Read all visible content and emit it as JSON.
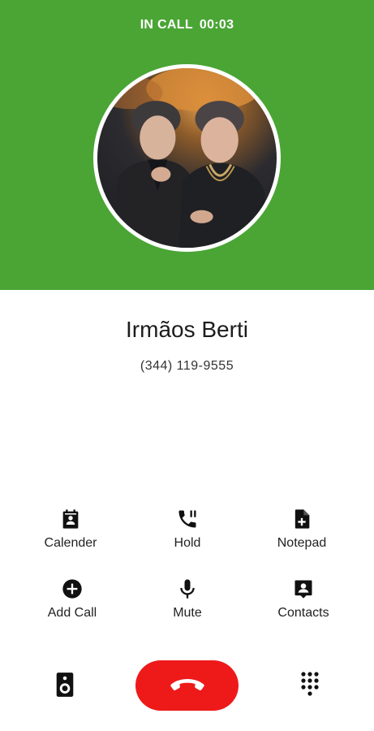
{
  "call": {
    "status_label": "IN CALL",
    "duration": "00:03"
  },
  "contact": {
    "name": "Irmãos Berti",
    "number": "(344) 119-9555"
  },
  "actions": [
    {
      "label": "Calender",
      "icon": "calendar-icon"
    },
    {
      "label": "Hold",
      "icon": "phone-pause-icon"
    },
    {
      "label": "Notepad",
      "icon": "note-add-icon"
    },
    {
      "label": "Add Call",
      "icon": "add-circle-icon"
    },
    {
      "label": "Mute",
      "icon": "microphone-icon"
    },
    {
      "label": "Contacts",
      "icon": "contact-icon"
    }
  ],
  "bottom_bar": {
    "left_icon": "speaker-icon",
    "center_icon": "end-call-icon",
    "right_icon": "dialpad-icon"
  },
  "colors": {
    "header_green": "#4aa535",
    "end_call_red": "#ee1a1a",
    "text_dark": "#1c1c1c"
  }
}
